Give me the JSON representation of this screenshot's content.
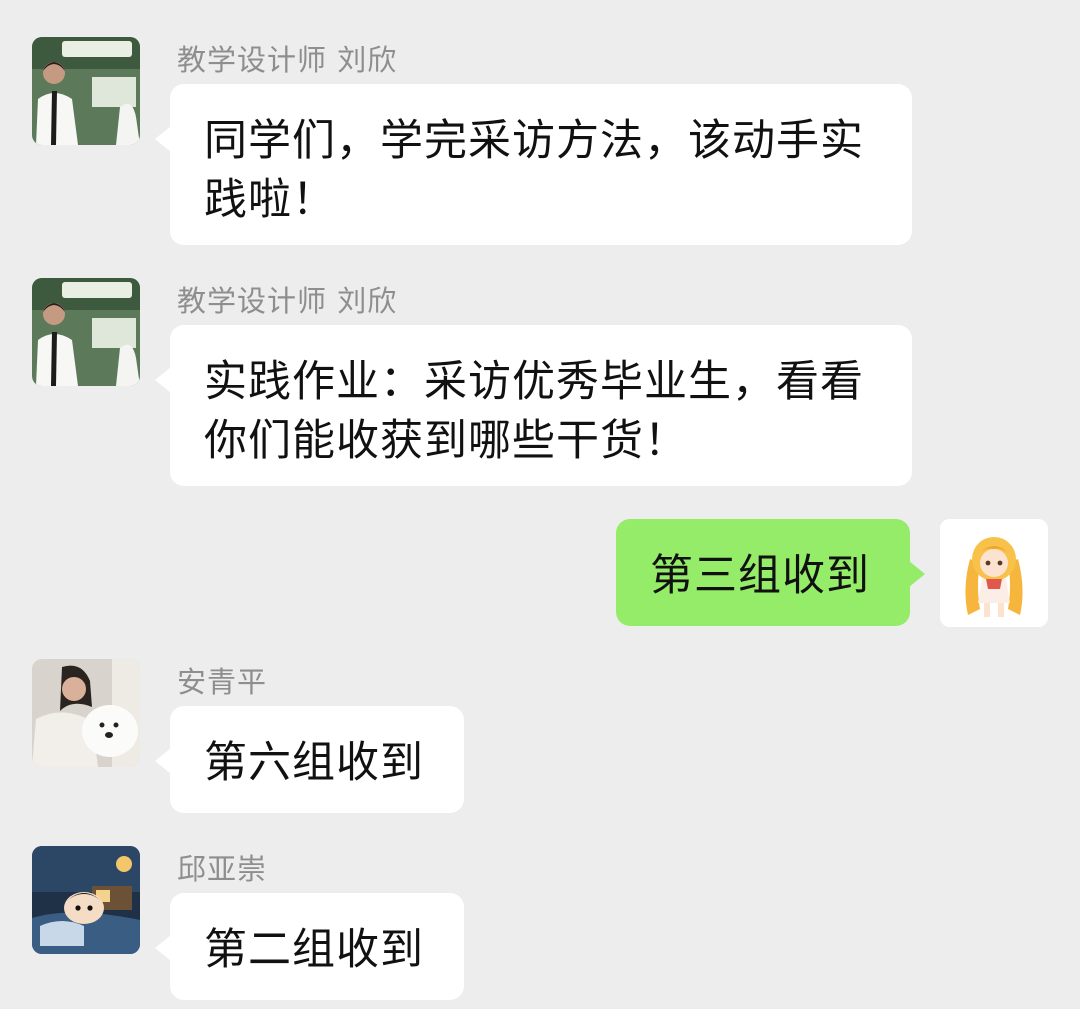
{
  "messages": [
    {
      "sender": "教学设计师 刘欣",
      "direction": "incoming",
      "avatar_icon": "teacher-photo-avatar",
      "lines": [
        "同学们，学完采访方法，该动手实",
        "践啦！"
      ]
    },
    {
      "sender": "教学设计师 刘欣",
      "direction": "incoming",
      "avatar_icon": "teacher-photo-avatar",
      "lines": [
        "实践作业：采访优秀毕业生，看看",
        "你们能收获到哪些干货！"
      ]
    },
    {
      "sender": "",
      "direction": "outgoing",
      "avatar_icon": "anime-girl-avatar",
      "lines": [
        "第三组收到"
      ]
    },
    {
      "sender": "安青平",
      "direction": "incoming",
      "avatar_icon": "woman-with-dog-avatar",
      "lines": [
        "第六组收到"
      ]
    },
    {
      "sender": "邱亚崇",
      "direction": "incoming",
      "avatar_icon": "cartoon-boy-avatar",
      "lines": [
        "第二组收到"
      ]
    }
  ],
  "colors": {
    "background": "#ededed",
    "incoming_bubble": "#ffffff",
    "outgoing_bubble": "#95ec69",
    "sender_name": "#8e8e8e"
  }
}
